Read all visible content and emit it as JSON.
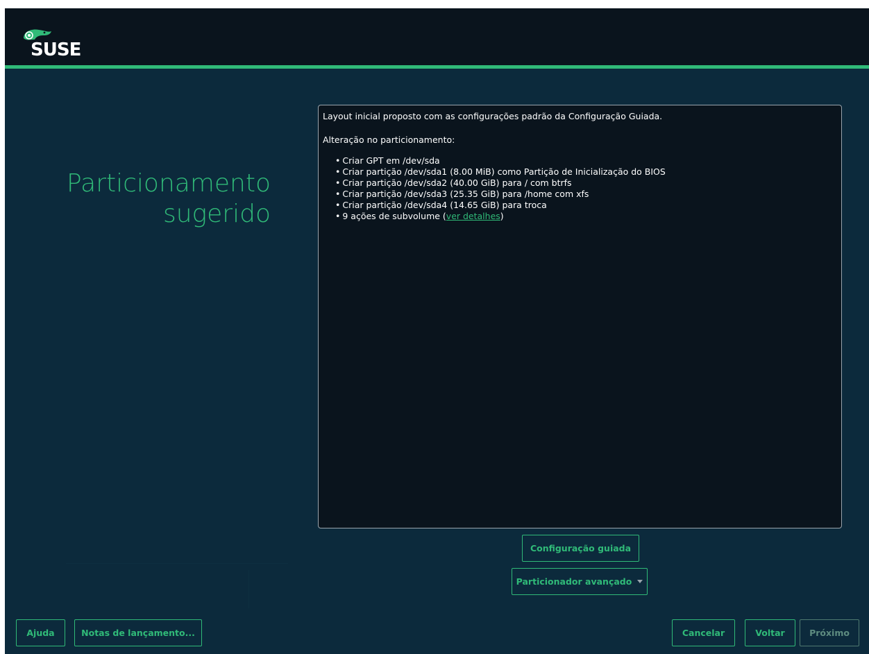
{
  "header": {
    "logo_text": "SUSE",
    "brand_color": "#30ba78",
    "logo_icon": "suse-chameleon-icon"
  },
  "title": {
    "line1": "Particionamento",
    "line2": "sugerido"
  },
  "summary": {
    "intro": "Layout inicial proposto com as configurações padrão da Configuração Guiada.",
    "changes_title": "Alteração no particionamento:",
    "actions": [
      "Criar GPT em /dev/sda",
      "Criar partição /dev/sda1 (8.00 MiB) como Partição de Inicialização do BIOS",
      "Criar partição /dev/sda2 (40.00 GiB) para / com btrfs",
      "Criar partição /dev/sda3 (25.35 GiB) para /home com xfs",
      "Criar partição /dev/sda4 (14.65 GiB) para troca"
    ],
    "subvolume_prefix": "9 ações de subvolume (",
    "subvolume_link": "ver detalhes",
    "subvolume_suffix": ")"
  },
  "buttons": {
    "guided_setup": "Configuração guiada",
    "expert_partitioner": "Particionador avançado",
    "help": "Ajuda",
    "release_notes": "Notas de lançamento...",
    "cancel": "Cancelar",
    "back": "Voltar",
    "next": "Próximo"
  },
  "colors": {
    "background": "#0c2a3c",
    "header": "#0a141d",
    "accent": "#30ba78",
    "text": "#ffffff"
  }
}
